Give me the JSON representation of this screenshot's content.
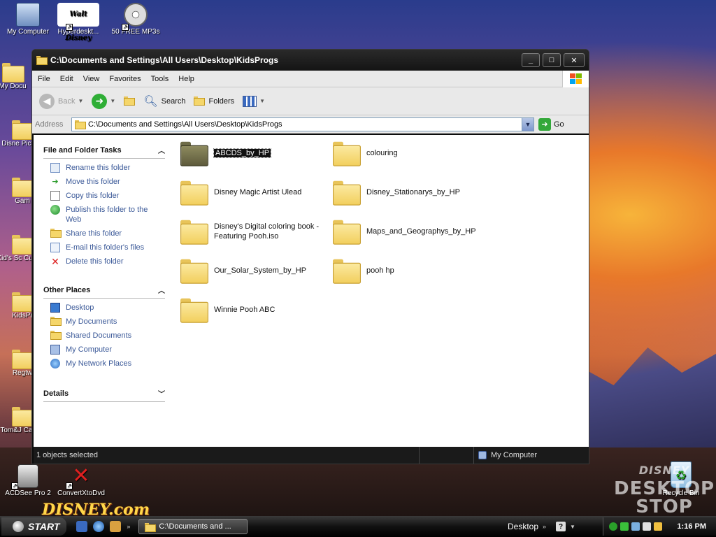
{
  "desktop": {
    "icons": [
      {
        "label": "My Computer"
      },
      {
        "label": "Hyperdeskt..."
      },
      {
        "label": "50 FREE MP3s"
      },
      {
        "label": "My Docu"
      },
      {
        "label": "Disne Picture"
      },
      {
        "label": "Gam"
      },
      {
        "label": "Kid's Sc Custom"
      },
      {
        "label": "KidsPr"
      },
      {
        "label": "Regtw"
      },
      {
        "label": "Tom&J Cartoo"
      },
      {
        "label": "ACDSee Pro 2"
      },
      {
        "label": "ConvertXtoDvd"
      },
      {
        "label": "Recycle Bin"
      }
    ],
    "logo_disney_com": "DISNEY.com",
    "logo_desktop_stop_top": "DISNEY",
    "logo_desktop_stop_line1": "DESKTOP",
    "logo_desktop_stop_line2": "STOP"
  },
  "window": {
    "title": "C:\\Documents and Settings\\All Users\\Desktop\\KidsProgs",
    "controls": {
      "minimize": "_",
      "maximize": "□",
      "close": "✕"
    },
    "menu": [
      "File",
      "Edit",
      "View",
      "Favorites",
      "Tools",
      "Help"
    ],
    "toolbar": {
      "back": "Back",
      "search": "Search",
      "folders": "Folders"
    },
    "address": {
      "label": "Address",
      "value": "C:\\Documents and Settings\\All Users\\Desktop\\KidsProgs",
      "go": "Go"
    },
    "tasks_panel": {
      "title": "File and Folder Tasks",
      "items": [
        "Rename this folder",
        "Move this folder",
        "Copy this folder",
        "Publish this folder to the Web",
        "Share this folder",
        "E-mail this folder's files",
        "Delete this folder"
      ]
    },
    "other_places": {
      "title": "Other Places",
      "items": [
        "Desktop",
        "My Documents",
        "Shared Documents",
        "My Computer",
        "My Network Places"
      ]
    },
    "details": {
      "title": "Details"
    },
    "folders": [
      {
        "name": "ABCDS_by_HP",
        "selected": true
      },
      {
        "name": "colouring"
      },
      {
        "name": "Disney Magic Artist Ulead"
      },
      {
        "name": "Disney_Stationarys_by_HP"
      },
      {
        "name": "Disney's Digital coloring book - Featuring Pooh.iso"
      },
      {
        "name": "Maps_and_Geographys_by_HP"
      },
      {
        "name": "Our_Solar_System_by_HP"
      },
      {
        "name": "pooh hp"
      },
      {
        "name": "Winnie Pooh ABC"
      }
    ],
    "status": {
      "selection": "1 objects selected",
      "zone": "My Computer"
    }
  },
  "taskbar": {
    "start": "START",
    "task_button": "C:\\Documents and ...",
    "toolbar_label": "Desktop",
    "help": "?",
    "clock": "1:16 PM"
  }
}
